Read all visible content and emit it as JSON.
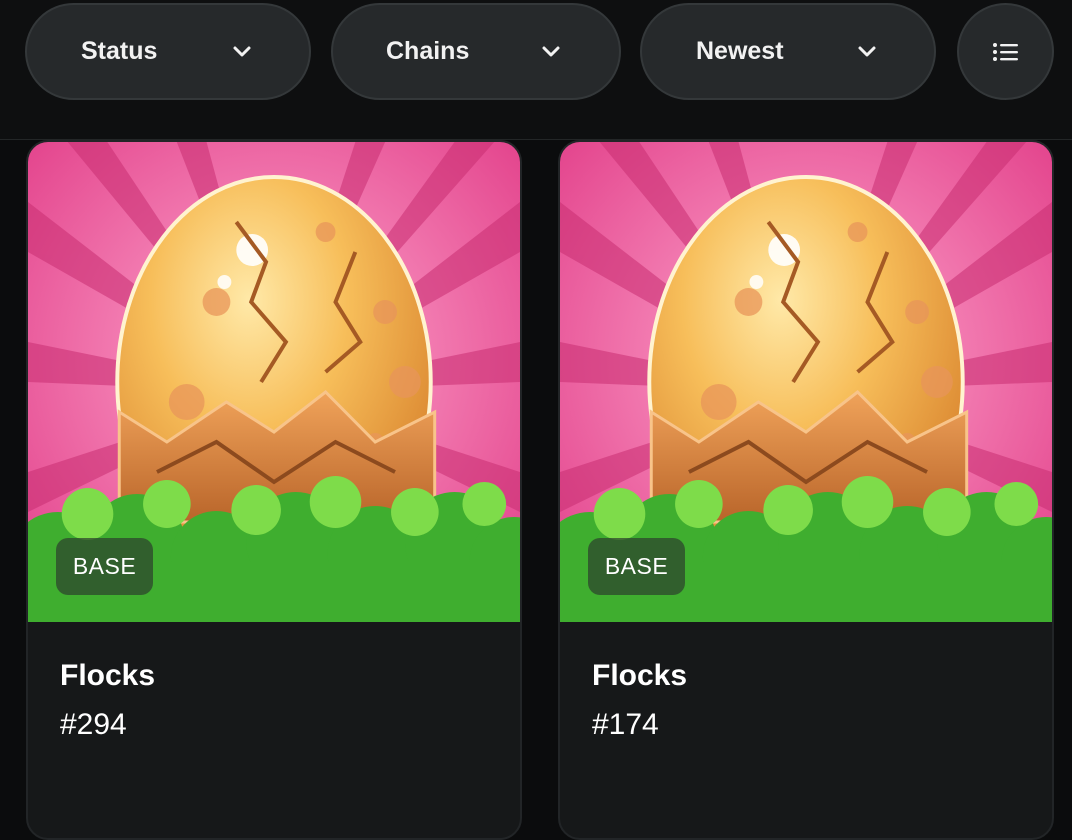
{
  "filters": {
    "status": {
      "label": "Status",
      "icon": "chevron-down-icon"
    },
    "chains": {
      "label": "Chains",
      "icon": "chevron-down-icon"
    },
    "sort": {
      "label": "Newest",
      "icon": "chevron-down-icon"
    },
    "view_toggle": {
      "icon": "list-icon"
    }
  },
  "cards": [
    {
      "chain": "BASE",
      "collection": "Flocks",
      "token_id": "#294",
      "image": "golden-egg-illustration"
    },
    {
      "chain": "BASE",
      "collection": "Flocks",
      "token_id": "#174",
      "image": "golden-egg-illustration"
    }
  ],
  "colors": {
    "background": "#0b0c0d",
    "pill": "#26292b",
    "card": "#161819",
    "art_pink": "#e8448e",
    "art_gold": "#f4b24a",
    "art_green": "#4fc43c"
  }
}
